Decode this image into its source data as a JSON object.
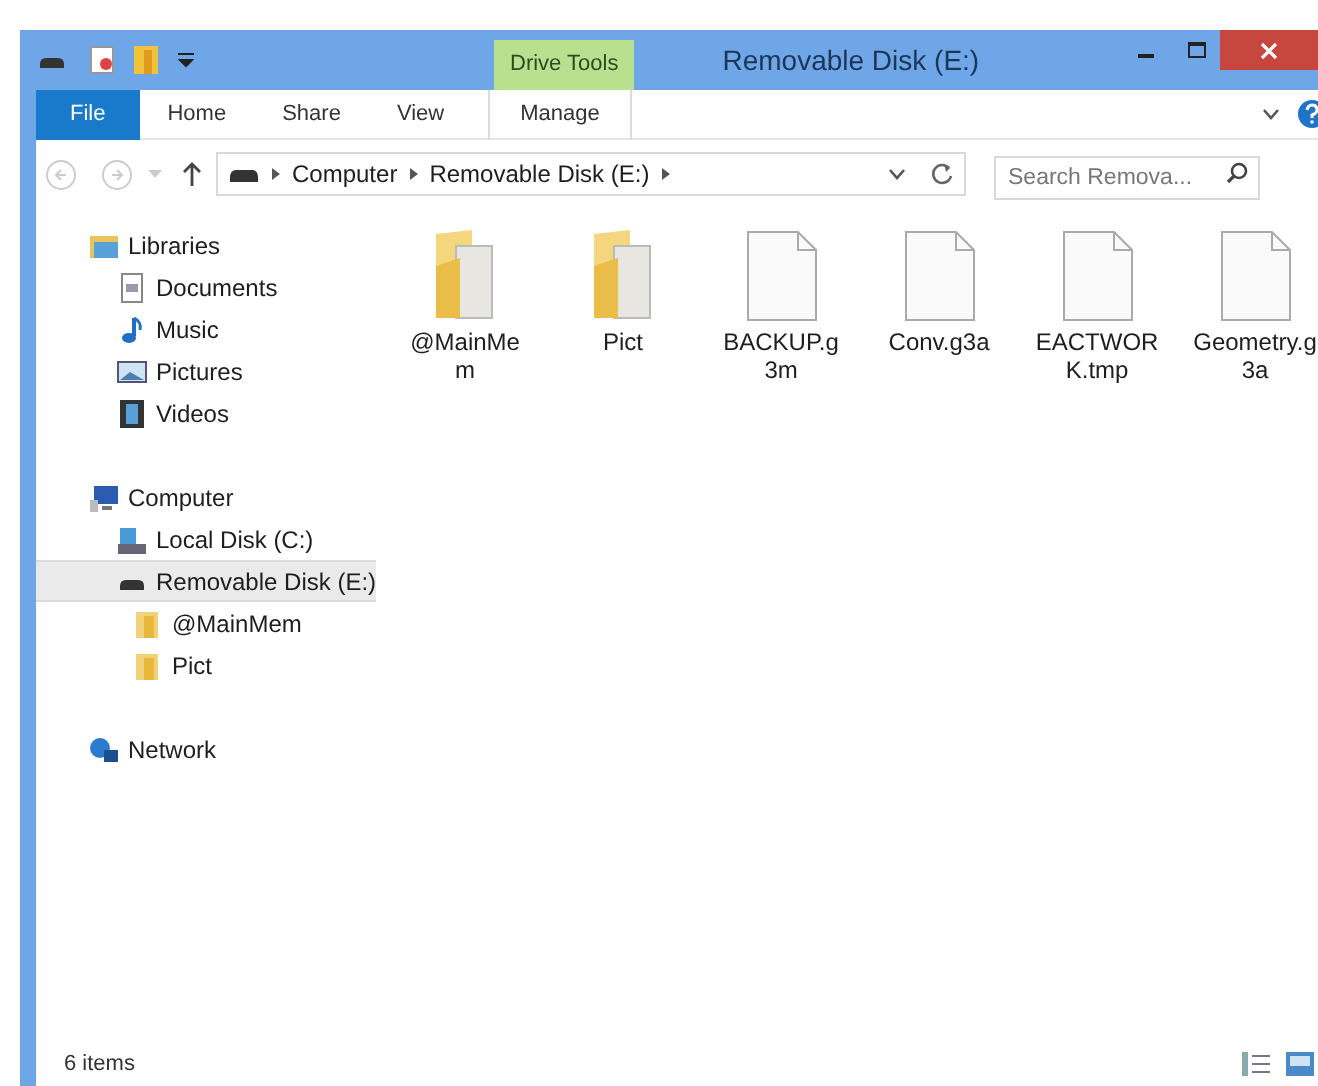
{
  "window": {
    "title": "Removable Disk (E:)",
    "context_group": "Drive Tools"
  },
  "ribbon_tabs": [
    {
      "label": "File",
      "kind": "file"
    },
    {
      "label": "Home",
      "kind": "normal"
    },
    {
      "label": "Share",
      "kind": "normal"
    },
    {
      "label": "View",
      "kind": "normal"
    },
    {
      "label": "Manage",
      "kind": "contextual"
    }
  ],
  "address_bar": {
    "path": [
      "Computer",
      "Removable Disk (E:)"
    ]
  },
  "search": {
    "placeholder": "Search Remova..."
  },
  "sidebar": {
    "items": [
      {
        "label": "Libraries",
        "kind": "libraries",
        "selected": false,
        "children": [
          {
            "label": "Documents",
            "kind": "documents",
            "selected": false
          },
          {
            "label": "Music",
            "kind": "music",
            "selected": false
          },
          {
            "label": "Pictures",
            "kind": "pictures",
            "selected": false
          },
          {
            "label": "Videos",
            "kind": "videos",
            "selected": false
          }
        ]
      },
      {
        "label": "Computer",
        "kind": "computer",
        "selected": false,
        "children": [
          {
            "label": "Local Disk (C:)",
            "kind": "harddisk",
            "selected": false
          },
          {
            "label": "Removable Disk (E:)",
            "kind": "removable",
            "selected": true,
            "children": [
              {
                "label": "@MainMem",
                "kind": "folder",
                "selected": false
              },
              {
                "label": "Pict",
                "kind": "folder",
                "selected": false
              }
            ]
          }
        ]
      },
      {
        "label": "Network",
        "kind": "network",
        "selected": false
      }
    ]
  },
  "files": [
    {
      "name": "@MainMem",
      "kind": "folder"
    },
    {
      "name": "Pict",
      "kind": "folder"
    },
    {
      "name": "BACKUP.g3m",
      "kind": "file"
    },
    {
      "name": "Conv.g3a",
      "kind": "file"
    },
    {
      "name": "EACTWORK.tmp",
      "kind": "file"
    },
    {
      "name": "Geometry.g3a",
      "kind": "file"
    }
  ],
  "status_bar": {
    "count": "6 items"
  }
}
